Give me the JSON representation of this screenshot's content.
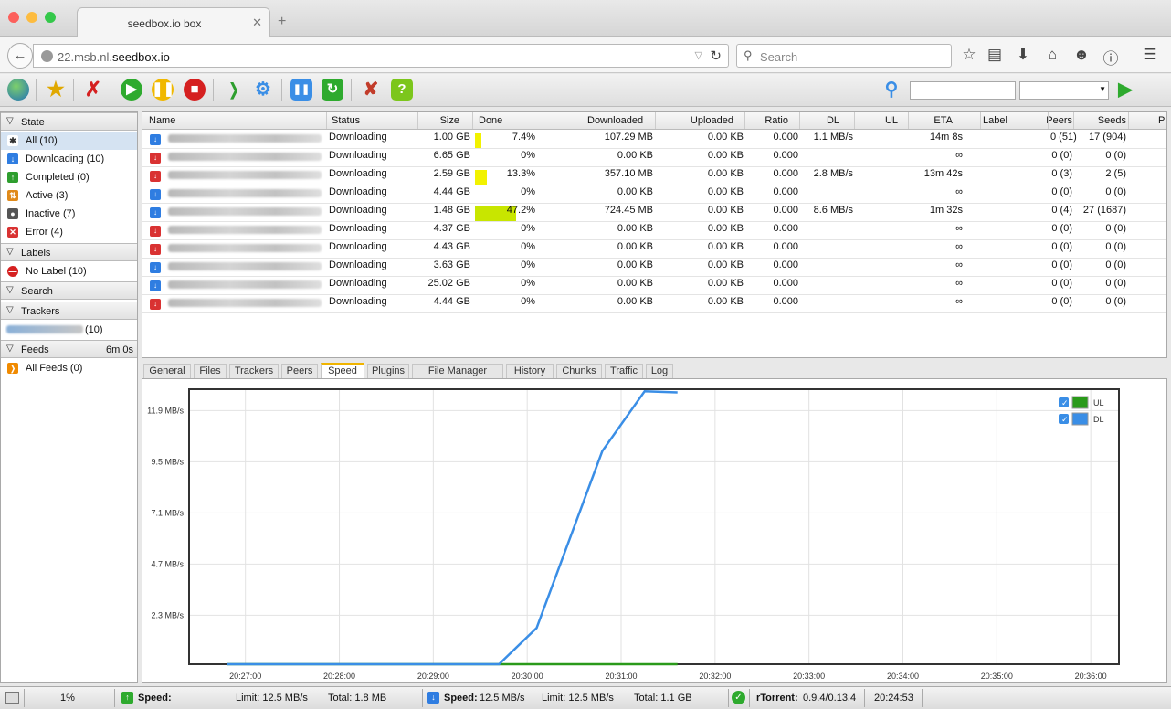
{
  "browser": {
    "tab_title": "seedbox.io box",
    "tab_close": "✕",
    "new_tab": "+",
    "url_prefix": "22.msb.nl.",
    "url_domain": "seedbox.io",
    "search_placeholder": "Search",
    "nav_icons": [
      "star-icon",
      "reading-list-icon",
      "download-icon",
      "home-icon",
      "chat-icon",
      "info-icon",
      "menu-icon"
    ]
  },
  "toolbar": {
    "icons": [
      "add-torrent-icon",
      "add-url-icon",
      "remove-icon",
      "start-icon",
      "pause-icon",
      "stop-icon",
      "rss-icon",
      "settings-icon",
      "window-icon",
      "refresh-icon",
      "tools-icon",
      "help-icon"
    ],
    "help_label": "?"
  },
  "sidebar": {
    "state_header": "State",
    "state_items": [
      {
        "label": "All (10)",
        "color": "#ffffff",
        "glyph": "✱"
      },
      {
        "label": "Downloading (10)",
        "color": "#2f7de1",
        "glyph": "↓"
      },
      {
        "label": "Completed (0)",
        "color": "#2e9e2e",
        "glyph": "↑"
      },
      {
        "label": "Active (3)",
        "color": "#e08a1a",
        "glyph": "⇅"
      },
      {
        "label": "Inactive (7)",
        "color": "#555555",
        "glyph": "●"
      },
      {
        "label": "Error (4)",
        "color": "#d93232",
        "glyph": "✕"
      }
    ],
    "labels_header": "Labels",
    "labels_items": [
      {
        "label": "No Label (10)"
      }
    ],
    "search_header": "Search",
    "trackers_header": "Trackers",
    "trackers_items": [
      {
        "label": "(10)"
      }
    ],
    "feeds_header": "Feeds",
    "feeds_time": "6m 0s",
    "feeds_items": [
      {
        "label": "All Feeds (0)"
      }
    ]
  },
  "list": {
    "columns": [
      "Name",
      "Status",
      "Size",
      "Done",
      "Downloaded",
      "Uploaded",
      "Ratio",
      "DL",
      "UL",
      "ETA",
      "Label",
      "Peers",
      "Seeds",
      "P"
    ],
    "rows": [
      {
        "icon": "blue",
        "status": "Downloading",
        "size": "1.00 GB",
        "done": "7.4%",
        "done_frac": 0.074,
        "bar_color": "#f2f200",
        "downloaded": "107.29 MB",
        "uploaded": "0.00 KB",
        "ratio": "0.000",
        "dl": "1.1 MB/s",
        "ul": "",
        "eta": "14m 8s",
        "label": "",
        "peers": "0 (51)",
        "seeds": "17 (904)"
      },
      {
        "icon": "red",
        "status": "Downloading",
        "size": "6.65 GB",
        "done": "0%",
        "done_frac": 0,
        "bar_color": "#f2f200",
        "downloaded": "0.00 KB",
        "uploaded": "0.00 KB",
        "ratio": "0.000",
        "dl": "",
        "ul": "",
        "eta": "∞",
        "label": "",
        "peers": "0 (0)",
        "seeds": "0 (0)"
      },
      {
        "icon": "red",
        "status": "Downloading",
        "size": "2.59 GB",
        "done": "13.3%",
        "done_frac": 0.133,
        "bar_color": "#f2f200",
        "downloaded": "357.10 MB",
        "uploaded": "0.00 KB",
        "ratio": "0.000",
        "dl": "2.8 MB/s",
        "ul": "",
        "eta": "13m 42s",
        "label": "",
        "peers": "0 (3)",
        "seeds": "2 (5)"
      },
      {
        "icon": "blue",
        "status": "Downloading",
        "size": "4.44 GB",
        "done": "0%",
        "done_frac": 0,
        "bar_color": "#f2f200",
        "downloaded": "0.00 KB",
        "uploaded": "0.00 KB",
        "ratio": "0.000",
        "dl": "",
        "ul": "",
        "eta": "∞",
        "label": "",
        "peers": "0 (0)",
        "seeds": "0 (0)"
      },
      {
        "icon": "blue",
        "status": "Downloading",
        "size": "1.48 GB",
        "done": "47.2%",
        "done_frac": 0.472,
        "bar_color": "#c8e600",
        "downloaded": "724.45 MB",
        "uploaded": "0.00 KB",
        "ratio": "0.000",
        "dl": "8.6 MB/s",
        "ul": "",
        "eta": "1m 32s",
        "label": "",
        "peers": "0 (4)",
        "seeds": "27 (1687)"
      },
      {
        "icon": "red",
        "status": "Downloading",
        "size": "4.37 GB",
        "done": "0%",
        "done_frac": 0,
        "bar_color": "#f2f200",
        "downloaded": "0.00 KB",
        "uploaded": "0.00 KB",
        "ratio": "0.000",
        "dl": "",
        "ul": "",
        "eta": "∞",
        "label": "",
        "peers": "0 (0)",
        "seeds": "0 (0)"
      },
      {
        "icon": "red",
        "status": "Downloading",
        "size": "4.43 GB",
        "done": "0%",
        "done_frac": 0,
        "bar_color": "#f2f200",
        "downloaded": "0.00 KB",
        "uploaded": "0.00 KB",
        "ratio": "0.000",
        "dl": "",
        "ul": "",
        "eta": "∞",
        "label": "",
        "peers": "0 (0)",
        "seeds": "0 (0)"
      },
      {
        "icon": "blue",
        "status": "Downloading",
        "size": "3.63 GB",
        "done": "0%",
        "done_frac": 0,
        "bar_color": "#f2f200",
        "downloaded": "0.00 KB",
        "uploaded": "0.00 KB",
        "ratio": "0.000",
        "dl": "",
        "ul": "",
        "eta": "∞",
        "label": "",
        "peers": "0 (0)",
        "seeds": "0 (0)"
      },
      {
        "icon": "blue",
        "status": "Downloading",
        "size": "25.02 GB",
        "done": "0%",
        "done_frac": 0,
        "bar_color": "#f2f200",
        "downloaded": "0.00 KB",
        "uploaded": "0.00 KB",
        "ratio": "0.000",
        "dl": "",
        "ul": "",
        "eta": "∞",
        "label": "",
        "peers": "0 (0)",
        "seeds": "0 (0)"
      },
      {
        "icon": "red",
        "status": "Downloading",
        "size": "4.44 GB",
        "done": "0%",
        "done_frac": 0,
        "bar_color": "#f2f200",
        "downloaded": "0.00 KB",
        "uploaded": "0.00 KB",
        "ratio": "0.000",
        "dl": "",
        "ul": "",
        "eta": "∞",
        "label": "",
        "peers": "0 (0)",
        "seeds": "0 (0)"
      }
    ]
  },
  "details_tabs": [
    "General",
    "Files",
    "Trackers",
    "Peers",
    "Speed",
    "Plugins",
    "File Manager",
    "History",
    "Chunks",
    "Traffic",
    "Log"
  ],
  "active_tab": "Speed",
  "chart_data": {
    "type": "line",
    "y_ticks": [
      "11.9 MB/s",
      "9.5 MB/s",
      "7.1 MB/s",
      "4.7 MB/s",
      "2.3 MB/s"
    ],
    "y_tick_values": [
      11.9,
      9.5,
      7.1,
      4.7,
      2.3
    ],
    "x_ticks": [
      "20:27:00",
      "20:28:00",
      "20:29:00",
      "20:30:00",
      "20:31:00",
      "20:32:00",
      "20:33:00",
      "20:34:00",
      "20:35:00",
      "20:36:00"
    ],
    "x_tick_minutes": [
      0,
      1,
      2,
      3,
      4,
      5,
      6,
      7,
      8,
      9
    ],
    "ylim": [
      0,
      12.9
    ],
    "xlim": [
      -0.6,
      9.3
    ],
    "grid": true,
    "legend_position": "top-right",
    "series": [
      {
        "name": "UL",
        "color": "#2a9a1a",
        "x": [
          -0.2,
          4.6
        ],
        "y": [
          0,
          0
        ]
      },
      {
        "name": "DL",
        "color": "#3a8ee6",
        "x": [
          -0.2,
          2.7,
          3.1,
          3.8,
          4.25,
          4.6
        ],
        "y": [
          0,
          0,
          1.7,
          10.0,
          12.8,
          12.75
        ]
      }
    ]
  },
  "status": {
    "percent": "1%",
    "ul_speed_label": "Speed:",
    "ul_speed_value": "",
    "ul_limit": "Limit: 12.5 MB/s",
    "ul_total": "Total: 1.8 MB",
    "dl_speed_label": "Speed:",
    "dl_speed_value": "12.5 MB/s",
    "dl_limit": "Limit: 12.5 MB/s",
    "dl_total": "Total: 1.1 GB",
    "client_label": "rTorrent:",
    "client_version": "0.9.4/0.13.4",
    "time": "20:24:53"
  }
}
